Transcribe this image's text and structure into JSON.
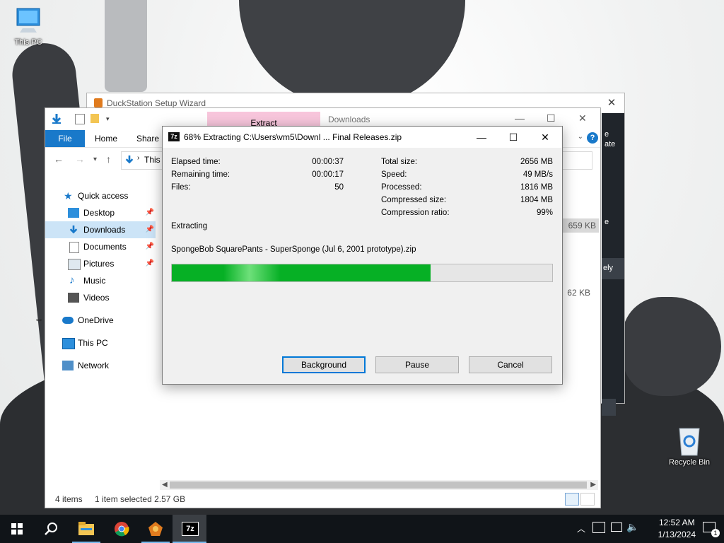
{
  "desktop": {
    "icons": [
      {
        "label": "This PC"
      },
      {
        "label": "Recycle Bin"
      }
    ]
  },
  "duckstation": {
    "title": "DuckStation Setup Wizard",
    "side_texts": [
      "e",
      "ate",
      "e",
      "ely"
    ]
  },
  "explorer": {
    "ribbon_context_tab": "Extract",
    "window_title": "Downloads",
    "tabs": [
      "File",
      "Home",
      "Share"
    ],
    "address_path": "This",
    "nav": {
      "quick_access": "Quick access",
      "items": [
        {
          "label": "Desktop",
          "pinned": true
        },
        {
          "label": "Downloads",
          "pinned": true,
          "selected": true
        },
        {
          "label": "Documents",
          "pinned": true
        },
        {
          "label": "Pictures",
          "pinned": true
        },
        {
          "label": "Music",
          "pinned": false
        },
        {
          "label": "Videos",
          "pinned": false
        }
      ],
      "onedrive": "OneDrive",
      "this_pc": "This PC",
      "network": "Network"
    },
    "sizes": [
      "659 KB",
      "62 KB"
    ],
    "status": {
      "items": "4 items",
      "selected": "1 item selected  2.57 GB"
    }
  },
  "sevenzip": {
    "icon_text": "7z",
    "title": "68% Extracting C:\\Users\\vm5\\Downl ... Final Releases.zip",
    "progress_percent": 68,
    "left_stats": [
      {
        "label": "Elapsed time:",
        "value": "00:00:37"
      },
      {
        "label": "Remaining time:",
        "value": "00:00:17"
      },
      {
        "label": "Files:",
        "value": "50"
      }
    ],
    "right_stats": [
      {
        "label": "Total size:",
        "value": "2656 MB"
      },
      {
        "label": "Speed:",
        "value": "49 MB/s"
      },
      {
        "label": "Processed:",
        "value": "1816 MB"
      },
      {
        "label": "Compressed size:",
        "value": "1804 MB"
      },
      {
        "label": "Compression ratio:",
        "value": "99%"
      }
    ],
    "operation": "Extracting",
    "current_file": "SpongeBob SquarePants - SuperSponge (Jul 6, 2001 prototype).zip",
    "buttons": {
      "background": "Background",
      "pause": "Pause",
      "cancel": "Cancel"
    }
  },
  "taskbar": {
    "apps": [
      "start-icon",
      "search-icon",
      "file-explorer-icon",
      "chrome-icon",
      "duckstation-icon",
      "7zip-icon"
    ],
    "active_app_label": "7z",
    "time": "12:52 AM",
    "date": "1/13/2024",
    "notification_count": "1"
  },
  "colors": {
    "accent": "#1979ca",
    "progress": "#06b025",
    "taskbar": "#101418",
    "selection": "#cce4f7"
  }
}
